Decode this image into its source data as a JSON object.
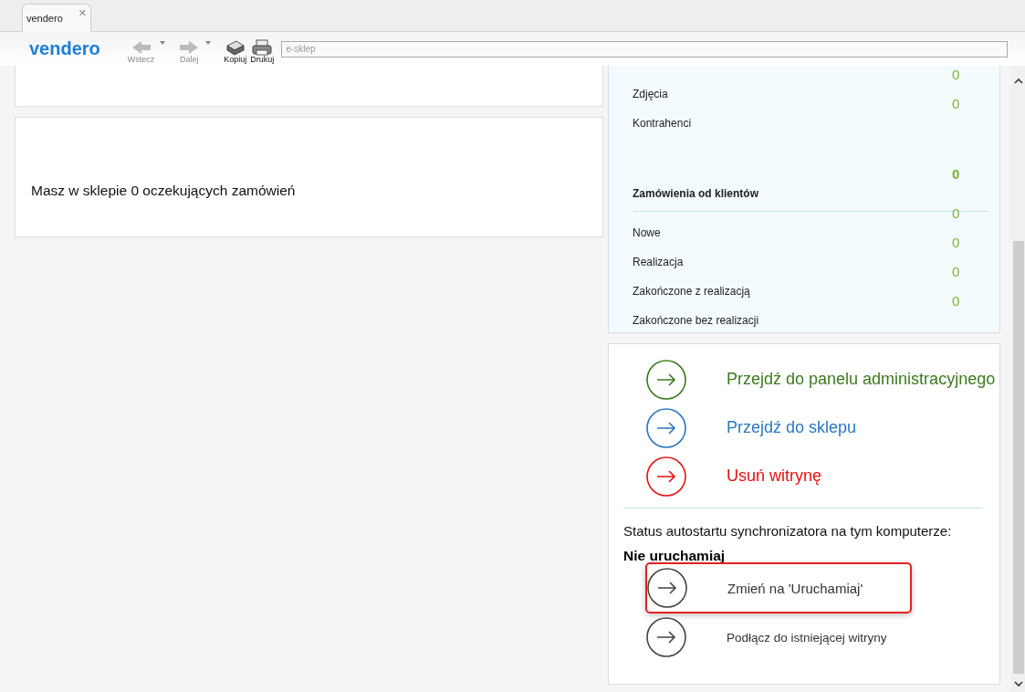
{
  "tabs": [
    {
      "label": "vendero",
      "selected": true,
      "close": "✕"
    }
  ],
  "toolbar": {
    "logo": "vendero",
    "buttons": [
      {
        "label": "Wstecz",
        "kind": "back",
        "disabled": true,
        "dropdown": true
      },
      {
        "label": "Dalej",
        "kind": "forward",
        "disabled": true,
        "dropdown": true
      },
      {
        "label": "Kopiuj",
        "kind": "copy",
        "disabled": false,
        "dropdown": false
      },
      {
        "label": "Drukuj",
        "kind": "print",
        "disabled": false,
        "dropdown": false
      }
    ],
    "address": {
      "placeholder": "e-sklep"
    }
  },
  "left_cards": [
    {
      "kind": "cut"
    },
    {
      "kind": "full",
      "text": "Masz w sklepie 0 oczekujących zamówień"
    }
  ],
  "stats": [
    {
      "kind": "item",
      "value": "0"
    },
    {
      "kind": "item",
      "label": "Zdjęcia",
      "value": "0"
    },
    {
      "kind": "item",
      "label": "Kontrahenci"
    },
    {
      "kind": "header",
      "label": "Zamówienia od klientów",
      "value": "0",
      "rule_value": "0"
    },
    {
      "kind": "item",
      "label": "Nowe",
      "value": "0"
    },
    {
      "kind": "item",
      "label": "Realizacja",
      "value": "0"
    },
    {
      "kind": "item",
      "label": "Zakończone z realizacją",
      "value": "0"
    },
    {
      "kind": "item",
      "label": "Zakończone bez realizacji"
    }
  ],
  "actions": [
    {
      "label": "Przejdź do panelu administracyjnego",
      "color": "#3d7a1e"
    },
    {
      "label": "Przejdź do sklepu",
      "color": "#2878c0"
    },
    {
      "label": "Usuń witrynę",
      "color": "#e81010"
    }
  ],
  "autostart": {
    "label": "Status autostartu synchronizatora na tym komputerze:",
    "status": "Nie uruchamiaj",
    "buttons": [
      {
        "label": "Zmień na 'Uruchamiaj'",
        "highlighted": true,
        "kind": "large"
      },
      {
        "label": "Podłącz do istniejącej witryny",
        "highlighted": false,
        "kind": "small"
      }
    ]
  }
}
